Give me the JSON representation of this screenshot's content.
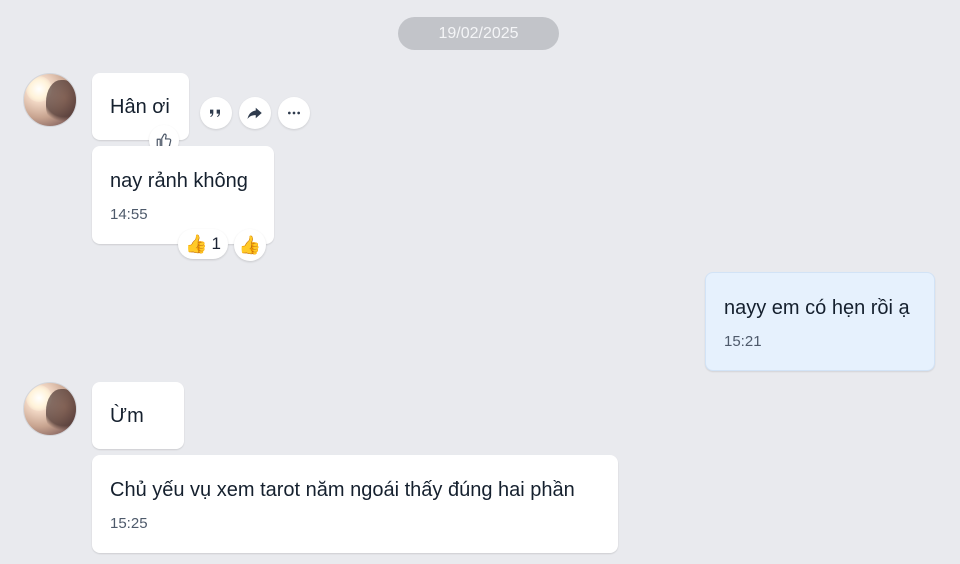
{
  "date_separator": "19/02/2025",
  "conversation": {
    "group1": {
      "messages": [
        {
          "text": "Hân ơi"
        },
        {
          "text": "nay rảnh không",
          "time": "14:55"
        }
      ],
      "message_actions": [
        "quote-icon",
        "share-icon",
        "more-icon"
      ],
      "reaction_count": "1"
    },
    "my_message": {
      "text": "nayy em có hẹn rồi ạ",
      "time": "15:21"
    },
    "group2": {
      "messages": [
        {
          "text": "Ừm"
        },
        {
          "text": "Chủ yếu vụ xem tarot năm ngoái thấy đúng hai phần",
          "time": "15:25"
        }
      ]
    }
  },
  "colors": {
    "background": "#e9eaee",
    "incoming_bubble": "#ffffff",
    "outgoing_bubble": "#e6f1fd",
    "date_pill": "#c2c4c9"
  }
}
